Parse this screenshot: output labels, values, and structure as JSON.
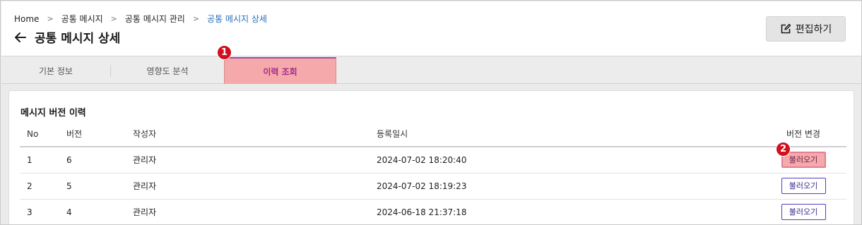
{
  "breadcrumb": {
    "items": [
      "Home",
      "공통 메시지",
      "공통 메시지 관리",
      "공통 메시지 상세"
    ]
  },
  "header": {
    "title": "공통 메시지 상세",
    "edit_label": "편집하기"
  },
  "tabs": [
    {
      "label": "기본 정보",
      "active": false
    },
    {
      "label": "영향도 분석",
      "active": false
    },
    {
      "label": "이력 조회",
      "active": true
    }
  ],
  "badges": [
    "1",
    "2"
  ],
  "history": {
    "title": "메시지 버전 이력",
    "columns": [
      "No",
      "버전",
      "작성자",
      "등록일시",
      "버전 변경"
    ],
    "rows": [
      {
        "no": "1",
        "version": "6",
        "author": "관리자",
        "date": "2024-07-02 18:20:40",
        "action": "불러오기"
      },
      {
        "no": "2",
        "version": "5",
        "author": "관리자",
        "date": "2024-07-02 18:19:23",
        "action": "불러오기"
      },
      {
        "no": "3",
        "version": "4",
        "author": "관리자",
        "date": "2024-06-18 21:37:18",
        "action": "불러오기"
      }
    ]
  },
  "colors": {
    "active_tab_bg": "#f6a9aa",
    "active_tab_text": "#a12a8f",
    "badge": "#d10f1e",
    "breadcrumb_current": "#2a6fb4",
    "button_border": "#5a3bbf"
  }
}
